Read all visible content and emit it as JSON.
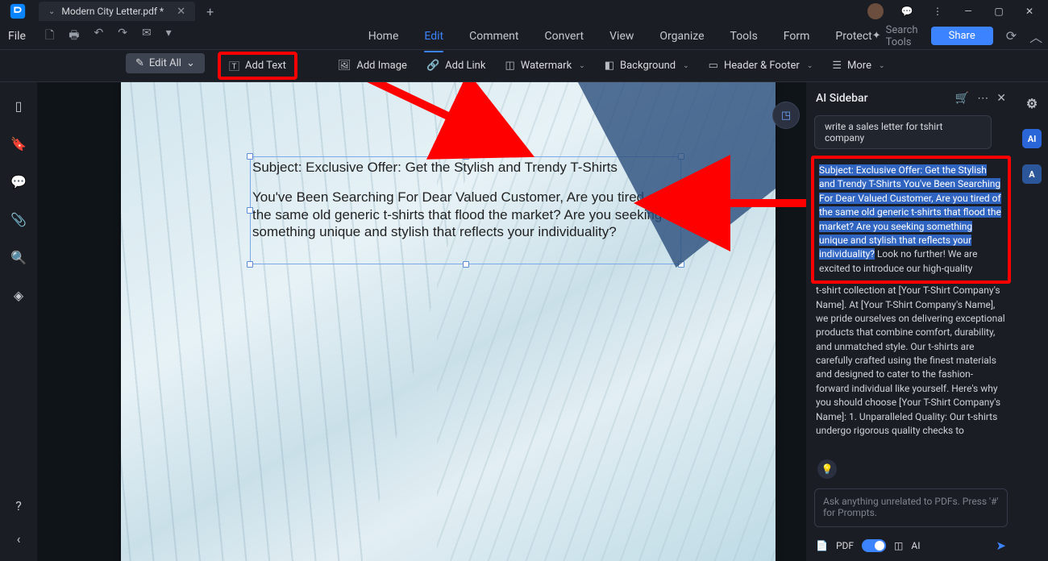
{
  "titlebar": {
    "filename": "Modern City Letter.pdf *"
  },
  "menu": {
    "file": "File",
    "search_ph": "Search Tools",
    "share": "Share"
  },
  "nav": {
    "home": "Home",
    "edit": "Edit",
    "comment": "Comment",
    "convert": "Convert",
    "view": "View",
    "organize": "Organize",
    "tools": "Tools",
    "form": "Form",
    "protect": "Protect"
  },
  "ribbon": {
    "editall": "Edit All",
    "addtext": "Add Text",
    "addimage": "Add Image",
    "addlink": "Add Link",
    "watermark": "Watermark",
    "background": "Background",
    "headerfooter": "Header & Footer",
    "more": "More"
  },
  "doc": {
    "subject": "Subject: Exclusive Offer: Get the Stylish and Trendy T-Shirts",
    "body": "You've Been Searching For Dear Valued Customer, Are you tired of the same old generic t-shirts that flood the market? Are you seeking something unique and stylish that reflects your individuality?"
  },
  "sidebar": {
    "title": "AI Sidebar",
    "user_query": "write a sales letter for tshirt company",
    "resp_hl": "Subject: Exclusive Offer: Get the Stylish and Trendy T-Shirts You've Been Searching For Dear Valued Customer, Are you tired of the same old generic t-shirts that flood the market? Are you seeking something unique and stylish that reflects your individuality?",
    "resp_tail": " Look no further! We are excited to introduce our high-quality ",
    "resp_rest": "t-shirt collection at [Your T-Shirt Company's Name]. At [Your T-Shirt Company's Name], we pride ourselves on delivering exceptional products that combine comfort, durability, and unmatched style. Our t-shirts are carefully crafted using the finest materials and designed to cater to the fashion-forward individual like yourself. Here's why you should choose [Your T-Shirt Company's Name]: 1. Unparalleled Quality: Our t-shirts undergo rigorous quality checks to",
    "input_ph": "Ask anything unrelated to PDFs. Press '#' for Prompts.",
    "pdf_label": "PDF",
    "ai_label": "AI"
  }
}
